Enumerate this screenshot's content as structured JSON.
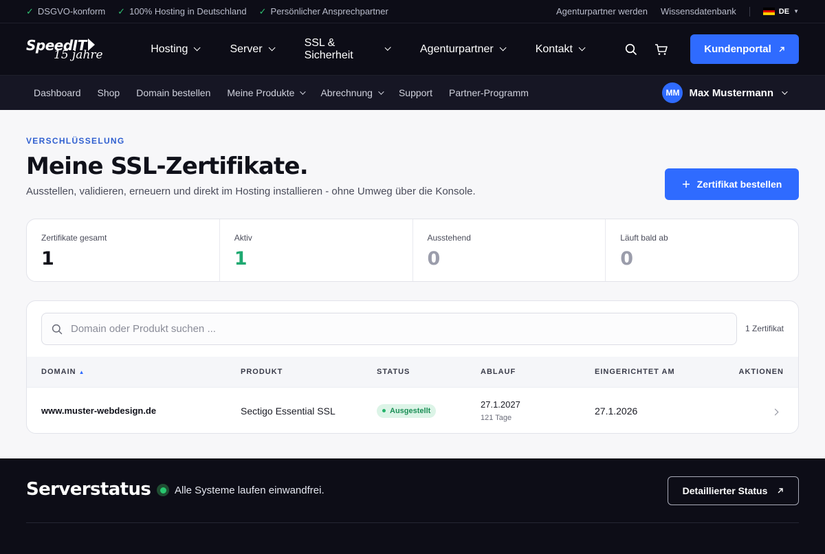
{
  "topbar": {
    "trust": [
      "DSGVO-konform",
      "100% Hosting in Deutschland",
      "Persönlicher Ansprechpartner"
    ],
    "links": [
      "Agenturpartner werden",
      "Wissensdatenbank"
    ],
    "language": "DE"
  },
  "header": {
    "logo_brand": "SpeedIT",
    "logo_sub": "15 jahre",
    "nav": [
      "Hosting",
      "Server",
      "SSL & Sicherheit",
      "Agenturpartner",
      "Kontakt"
    ],
    "portal_label": "Kundenportal"
  },
  "subnav": {
    "items": [
      {
        "label": "Dashboard",
        "dropdown": false
      },
      {
        "label": "Shop",
        "dropdown": false
      },
      {
        "label": "Domain bestellen",
        "dropdown": false
      },
      {
        "label": "Meine Produkte",
        "dropdown": true
      },
      {
        "label": "Abrechnung",
        "dropdown": true
      },
      {
        "label": "Support",
        "dropdown": false
      },
      {
        "label": "Partner-Programm",
        "dropdown": false
      }
    ],
    "user_initials": "MM",
    "user_name": "Max Mustermann"
  },
  "page": {
    "eyebrow": "VERSCHLÜSSELUNG",
    "title": "Meine SSL-Zertifikate.",
    "subtitle": "Ausstellen, validieren, erneuern und direkt im Hosting installieren - ohne Umweg über die Konsole.",
    "order_button": "Zertifikat bestellen"
  },
  "stats": [
    {
      "label": "Zertifikate gesamt",
      "value": "1",
      "color": "#10111a"
    },
    {
      "label": "Aktiv",
      "value": "1",
      "color": "#1fa971"
    },
    {
      "label": "Ausstehend",
      "value": "0",
      "color": "#9b9dab"
    },
    {
      "label": "Läuft bald ab",
      "value": "0",
      "color": "#9b9dab"
    }
  ],
  "table": {
    "search_placeholder": "Domain oder Produkt suchen ...",
    "count": "1 Zertifikat",
    "columns": [
      "DOMAIN",
      "PRODUKT",
      "STATUS",
      "ABLAUF",
      "EINGERICHTET AM",
      "AKTIONEN"
    ],
    "sort_indicator": "▲",
    "rows": [
      {
        "domain": "www.muster-webdesign.de",
        "product": "Sectigo Essential SSL",
        "status": "Ausgestellt",
        "expiry_date": "27.1.2027",
        "expiry_days": "121 Tage",
        "created": "27.1.2026"
      }
    ]
  },
  "footer": {
    "title": "Serverstatus",
    "status_text": "Alle Systeme laufen einwandfrei.",
    "detail_button": "Detaillierter Status"
  },
  "colors": {
    "accent": "#2f6bff",
    "success": "#1fa971",
    "dark_bg": "#0d0d17"
  }
}
